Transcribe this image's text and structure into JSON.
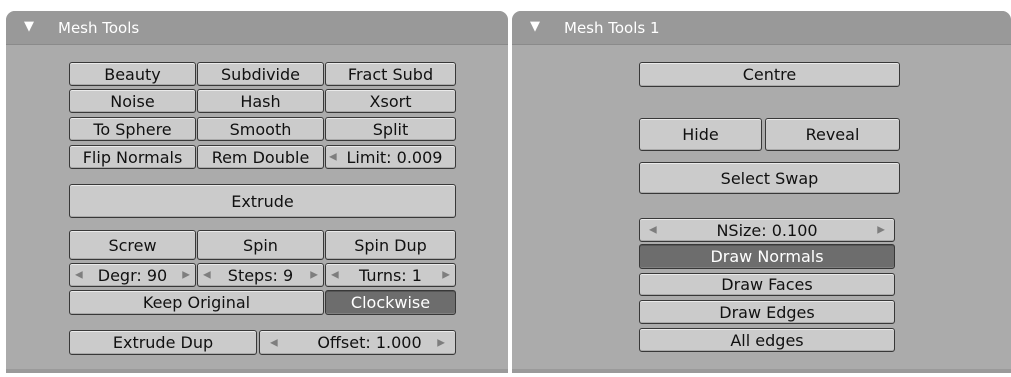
{
  "left_panel": {
    "title": "Mesh Tools",
    "grid_rows": [
      [
        "Beauty",
        "Subdivide",
        "Fract Subd"
      ],
      [
        "Noise",
        "Hash",
        "Xsort"
      ],
      [
        "To Sphere",
        "Smooth",
        "Split"
      ],
      [
        "Flip Normals",
        "Rem Double",
        "Limit: 0.009"
      ]
    ],
    "extrude": "Extrude",
    "screw": "Screw",
    "spin": "Spin",
    "spin_dup": "Spin Dup",
    "degr": "Degr: 90",
    "steps": "Steps: 9",
    "turns": "Turns: 1",
    "keep_original": "Keep Original",
    "clockwise": "Clockwise",
    "extrude_dup": "Extrude Dup",
    "offset": "Offset: 1.000"
  },
  "right_panel": {
    "title": "Mesh Tools 1",
    "centre": "Centre",
    "hide": "Hide",
    "reveal": "Reveal",
    "select_swap": "Select Swap",
    "nsize": "NSize: 0.100",
    "draw_normals": "Draw Normals",
    "draw_faces": "Draw Faces",
    "draw_edges": "Draw Edges",
    "all_edges": "All edges"
  },
  "colors": {
    "panel_bg": "#ababab",
    "header_bg": "#999999",
    "button_bg": "#cbcbcb",
    "active_bg": "#6d6d6d"
  },
  "icons": {
    "collapse": "triangle-down-icon",
    "decrement": "arrow-left-icon",
    "increment": "arrow-right-icon"
  }
}
